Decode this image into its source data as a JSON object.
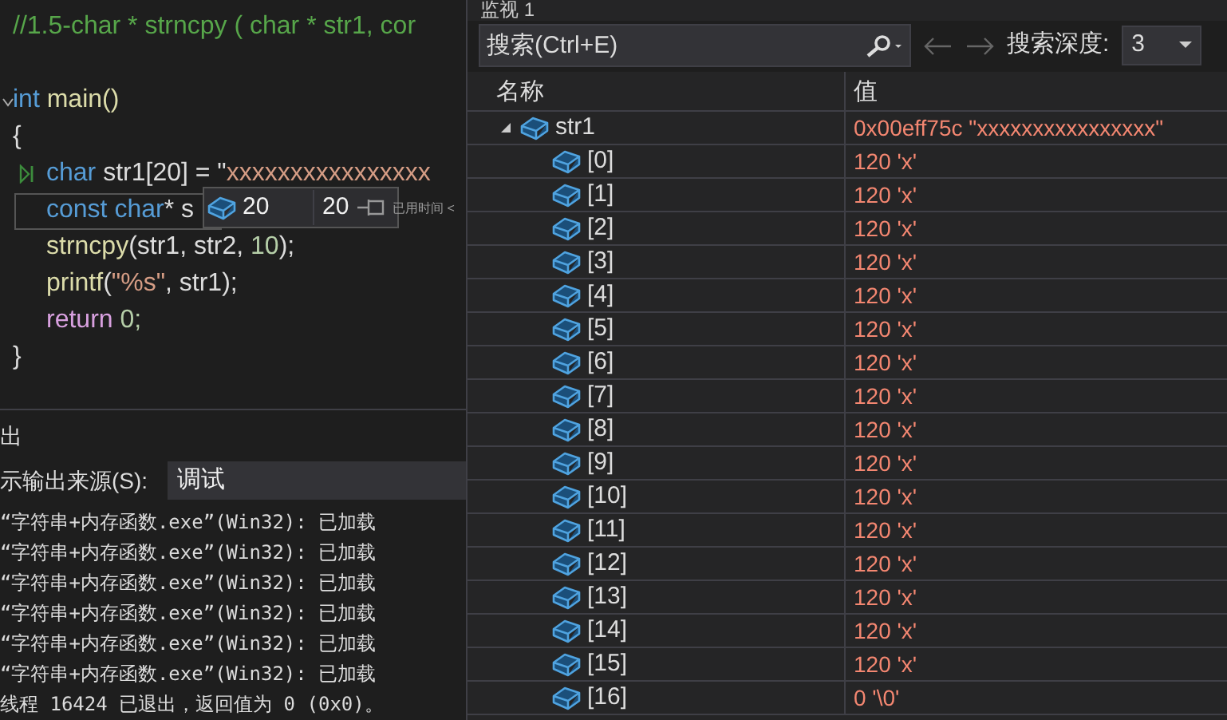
{
  "code_editor": {
    "lines": [
      {
        "tokens": [
          {
            "text": "//1.5-char * strncpy ( char * str1, cor",
            "kind": "comment"
          }
        ],
        "highlighted": false,
        "foldable": false,
        "current": false
      },
      {
        "highlighted": false,
        "foldable": false,
        "current": false
      },
      {
        "tokens": [
          {
            "text": "int",
            "kind": "keyword"
          },
          {
            "text": " main()",
            "kind": "func"
          }
        ],
        "highlighted": false,
        "foldable": true,
        "current": false
      },
      {
        "tokens": [
          {
            "text": "{",
            "kind": "plain"
          }
        ],
        "highlighted": false,
        "foldable": false,
        "current": false
      },
      {
        "tokens": [
          {
            "text": "char",
            "kind": "keyword"
          },
          {
            "text": " str1[20] = \"",
            "kind": "plain"
          },
          {
            "text": "xxxxxxxxxxxxxxxx",
            "kind": "string"
          }
        ],
        "highlighted": false,
        "foldable": false,
        "current": true
      },
      {
        "tokens": [
          {
            "text": "const char",
            "kind": "keyword"
          },
          {
            "text": "* s",
            "kind": "plain"
          }
        ],
        "highlighted": true,
        "foldable": false,
        "current": false
      },
      {
        "tokens": [
          {
            "text": "strncpy",
            "kind": "func"
          },
          {
            "text": "(str1, str2, ",
            "kind": "plain"
          },
          {
            "text": "10",
            "kind": "number"
          },
          {
            "text": ");",
            "kind": "plain"
          }
        ],
        "highlighted": false,
        "foldable": false,
        "current": false
      },
      {
        "tokens": [
          {
            "text": "printf",
            "kind": "func"
          },
          {
            "text": "(",
            "kind": "plain"
          },
          {
            "text": "\"%s\"",
            "kind": "string"
          },
          {
            "text": ", str1);",
            "kind": "plain"
          }
        ],
        "highlighted": false,
        "foldable": false,
        "current": false
      },
      {
        "tokens": [
          {
            "text": "return",
            "kind": "control"
          },
          {
            "text": " 0;",
            "kind": "number"
          }
        ],
        "highlighted": false,
        "foldable": false,
        "current": false
      },
      {
        "tokens": [
          {
            "text": "}",
            "kind": "plain"
          }
        ],
        "highlighted": false,
        "foldable": false,
        "current": false
      }
    ]
  },
  "datatip": {
    "name": "20",
    "value": "20",
    "elapsed": "已用时间 <"
  },
  "output": {
    "title": "出",
    "source_label": "示输出来源(S):",
    "source": "调试",
    "lines": [
      "“字符串+内存函数.exe”(Win32): 已加载",
      "“字符串+内存函数.exe”(Win32): 已加载",
      "“字符串+内存函数.exe”(Win32): 已加载",
      "“字符串+内存函数.exe”(Win32): 已加载",
      "“字符串+内存函数.exe”(Win32): 已加载",
      "“字符串+内存函数.exe”(Win32): 已加载",
      "线程 16424 已退出，返回值为 0 (0x0)。"
    ]
  },
  "watch": {
    "title": "监视 1",
    "search": {
      "placeholder": "搜索(Ctrl+E)"
    },
    "depth_label": "搜索深度:",
    "depth": "3",
    "columns": [
      "名称",
      "值"
    ],
    "rows": [
      {
        "name": "str1",
        "value": "0x00eff75c \"xxxxxxxxxxxxxxxx\"",
        "expanded": true,
        "children": [
          {
            "name": "[0]",
            "value": "120 'x'"
          },
          {
            "name": "[1]",
            "value": "120 'x'"
          },
          {
            "name": "[2]",
            "value": "120 'x'"
          },
          {
            "name": "[3]",
            "value": "120 'x'"
          },
          {
            "name": "[4]",
            "value": "120 'x'"
          },
          {
            "name": "[5]",
            "value": "120 'x'"
          },
          {
            "name": "[6]",
            "value": "120 'x'"
          },
          {
            "name": "[7]",
            "value": "120 'x'"
          },
          {
            "name": "[8]",
            "value": "120 'x'"
          },
          {
            "name": "[9]",
            "value": "120 'x'"
          },
          {
            "name": "[10]",
            "value": "120 'x'"
          },
          {
            "name": "[11]",
            "value": "120 'x'"
          },
          {
            "name": "[12]",
            "value": "120 'x'"
          },
          {
            "name": "[13]",
            "value": "120 'x'"
          },
          {
            "name": "[14]",
            "value": "120 'x'"
          },
          {
            "name": "[15]",
            "value": "120 'x'"
          },
          {
            "name": "[16]",
            "value": "0 '\\0'"
          }
        ]
      }
    ]
  }
}
